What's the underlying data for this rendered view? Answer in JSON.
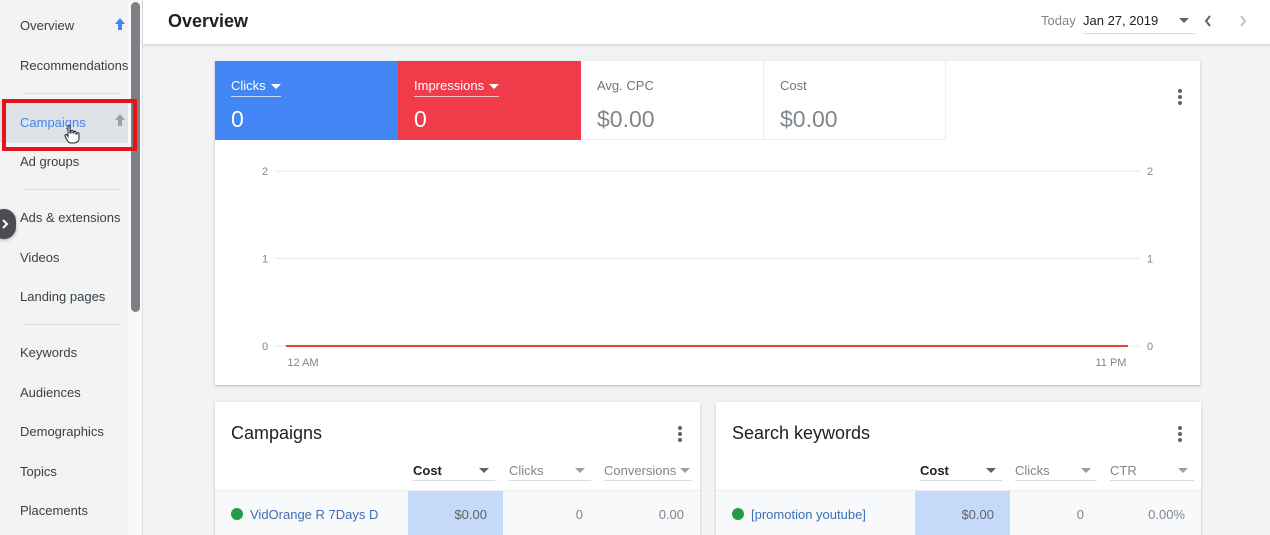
{
  "sidebar": {
    "items": [
      {
        "label": "Overview",
        "pinned": true
      },
      {
        "label": "Recommendations"
      },
      {
        "label": "Campaigns",
        "active": true,
        "pinned": true
      },
      {
        "label": "Ad groups"
      },
      {
        "label": "Ads & extensions"
      },
      {
        "label": "Videos"
      },
      {
        "label": "Landing pages"
      },
      {
        "label": "Keywords"
      },
      {
        "label": "Audiences"
      },
      {
        "label": "Demographics"
      },
      {
        "label": "Topics"
      },
      {
        "label": "Placements"
      }
    ]
  },
  "header": {
    "title": "Overview",
    "date_range_label": "Today",
    "date_value": "Jan 27, 2019"
  },
  "scorecards": [
    {
      "label": "Clicks",
      "value": "0",
      "color": "#4285f4"
    },
    {
      "label": "Impressions",
      "value": "0",
      "color": "#f03c4a"
    },
    {
      "label": "Avg. CPC",
      "value": "$0.00"
    },
    {
      "label": "Cost",
      "value": "$0.00"
    }
  ],
  "chart_data": {
    "type": "line",
    "title": "",
    "x": [
      "12 AM",
      "11 PM"
    ],
    "x_tick_labels": [
      "12 AM",
      "11 PM"
    ],
    "series": [
      {
        "name": "Clicks",
        "color": "#4285f4",
        "axis": "left",
        "values": [
          0,
          0
        ]
      },
      {
        "name": "Impressions",
        "color": "#db4437",
        "axis": "right",
        "values": [
          0,
          0
        ]
      }
    ],
    "y_left_ticks": [
      "0",
      "1",
      "2"
    ],
    "y_right_ticks": [
      "0",
      "1",
      "2"
    ],
    "ylim": [
      0,
      2
    ],
    "grid": true,
    "xlabel": "",
    "ylabel": ""
  },
  "campaigns_card": {
    "title": "Campaigns",
    "columns": [
      "Cost",
      "Clicks",
      "Conversions"
    ],
    "rows": [
      {
        "name": "VidOrange R 7Days D",
        "status": "enabled",
        "cells": [
          "$0.00",
          "0",
          "0.00"
        ]
      }
    ]
  },
  "keywords_card": {
    "title": "Search keywords",
    "columns": [
      "Cost",
      "Clicks",
      "CTR"
    ],
    "rows": [
      {
        "name": "[promotion youtube]",
        "status": "enabled",
        "cells": [
          "$0.00",
          "0",
          "0.00%"
        ]
      }
    ]
  }
}
